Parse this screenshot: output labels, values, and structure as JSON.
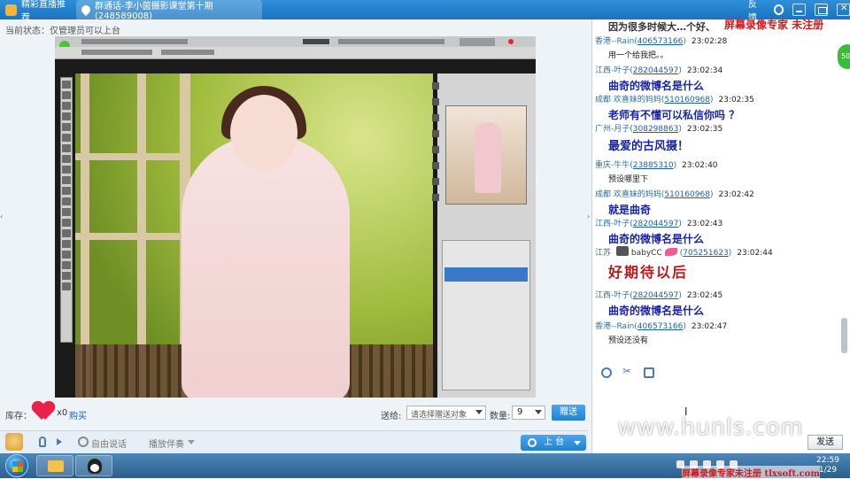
{
  "titlebar": {
    "tab1_label": "精彩直播推荐",
    "tab2_label": "群通话-李小茵摄影课堂第十期(248589008)",
    "feedback_label": "反馈"
  },
  "status_line": "当前状态：仅管理员可以上台",
  "gift": {
    "inventory_label": "库存：",
    "count": "x0",
    "buy_label": "购买",
    "to_label": "送给:",
    "target_placeholder": "请选择赠送对象",
    "qty_label": "数量:",
    "qty_value": "9",
    "send_label": "赠送"
  },
  "controls": {
    "free_speak_label": "自由说话",
    "accompany_label": "播放伴奏",
    "go_stage_label": "上 台"
  },
  "chat": {
    "partial_top": "因为很多时候大…个好、",
    "messages": [
      {
        "sender": "香港--Rain",
        "uid": "406573166",
        "time": "23:02:28",
        "text": "用一个给我把。。",
        "style": "small"
      },
      {
        "sender": "江西-叶子",
        "uid": "282044597",
        "time": "23:02:34",
        "text": "曲奇的微博名是什么",
        "style": "big"
      },
      {
        "sender": "成都 欢喜妹的妈妈",
        "uid": "510160968",
        "time": "23:02:35",
        "text": "老师有不懂可以私信你吗 ？",
        "style": "big"
      },
      {
        "sender": "广州-月子",
        "uid": "308298863",
        "time": "23:02:35",
        "text": "最爱的古风摄！",
        "style": "big"
      },
      {
        "sender": "重庆-牛牛",
        "uid": "23885310",
        "time": "23:02:40",
        "text": "预设哪里下",
        "style": "small"
      },
      {
        "sender": "成都 欢喜妹的妈妈",
        "uid": "510160968",
        "time": "23:02:42",
        "text": "就是曲奇",
        "style": "big"
      },
      {
        "sender": "江西-叶子",
        "uid": "282044597",
        "time": "23:02:43",
        "text": "曲奇的微博名是什么",
        "style": "big"
      },
      {
        "sender": "江苏",
        "uid": "705251623",
        "time": "23:02:44",
        "text": "好期待以后",
        "style": "huge",
        "nick": "babyCC"
      },
      {
        "sender": "江西-叶子",
        "uid": "282044597",
        "time": "23:02:45",
        "text": "曲奇的微博名是什么",
        "style": "big"
      },
      {
        "sender": "香港--Rain",
        "uid": "406573166",
        "time": "23:02:47",
        "text": "预设还没有",
        "style": "small"
      }
    ],
    "send_label": "发送"
  },
  "watermarks": {
    "top": "屏幕录像专家 未注册",
    "url": "www.hunls.com",
    "bottom": "屏幕录像专家未注册 tlxsoft.com"
  },
  "badge_text": "50",
  "clock": {
    "time": "22:59",
    "date": "1/29"
  },
  "icons": [
    "heart-gift-icon",
    "mic-icon",
    "speaker-icon",
    "emoji-icon",
    "scissors-icon",
    "image-icon",
    "camera-icon",
    "bow-icon",
    "folder-icon",
    "qq-icon",
    "windows-logo-icon"
  ]
}
